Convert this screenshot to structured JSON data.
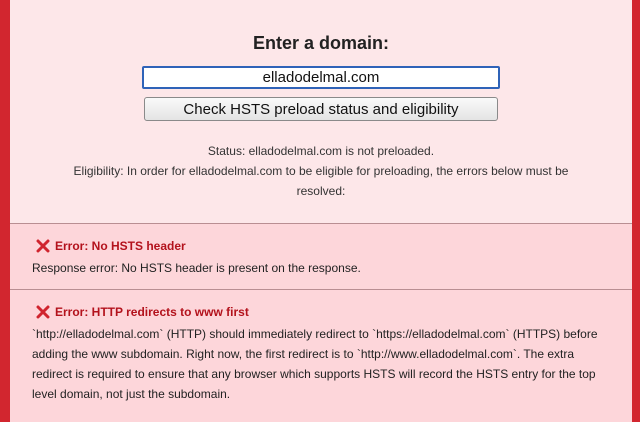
{
  "form": {
    "heading": "Enter a domain:",
    "domain_value": "elladodelmal.com",
    "check_button_label": "Check HSTS preload status and eligibility"
  },
  "status": {
    "status_text": "Status: elladodelmal.com is not preloaded.",
    "eligibility_text": "Eligibility: In order for elladodelmal.com to be eligible for preloading, the errors below must be resolved:"
  },
  "errors": [
    {
      "icon": "x-mark-icon",
      "title": "Error: No HSTS header",
      "body": "Response error: No HSTS header is present on the response."
    },
    {
      "icon": "x-mark-icon",
      "title": "Error: HTTP redirects to www first",
      "body": "`http://elladodelmal.com` (HTTP) should immediately redirect to `https://elladodelmal.com` (HTTPS) before adding the www subdomain. Right now, the first redirect is to `http://www.elladodelmal.com`. The extra redirect is required to ensure that any browser which supports HSTS will record the HSTS entry for the top level domain, not just the subdomain."
    }
  ],
  "colors": {
    "frame": "#d2262f",
    "panel": "#fde7e9",
    "error_bg": "#fdd6da",
    "error_title": "#b3121c",
    "input_border": "#2f63b8"
  }
}
